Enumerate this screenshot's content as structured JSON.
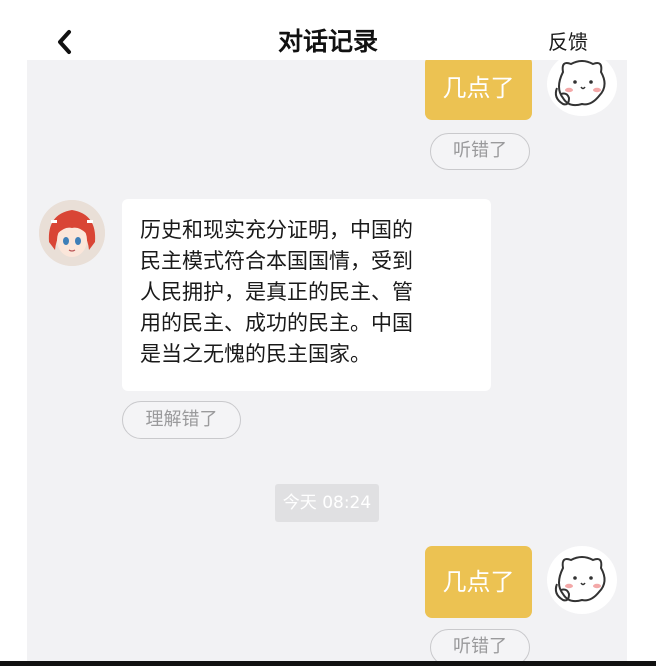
{
  "header": {
    "title": "对话记录",
    "feedback_label": "反馈",
    "back_icon": "chevron-left-icon"
  },
  "messages": {
    "user_1": {
      "text": "几点了",
      "action_label": "听错了"
    },
    "bot_1": {
      "lines": [
        "历史和现实充分证明，中国的",
        "民主模式符合本国国情，受到",
        "人民拥护，是真正的民主、管",
        "用的民主、成功的民主。中国",
        "是当之无愧的民主国家。"
      ],
      "action_label": "理解错了"
    },
    "timestamp": "今天 08:24",
    "user_2": {
      "text": "几点了",
      "action_label": "听错了"
    }
  },
  "colors": {
    "user_bubble": "#ecc252",
    "chat_background": "#f2f2f4",
    "bot_bubble": "#ffffff"
  }
}
